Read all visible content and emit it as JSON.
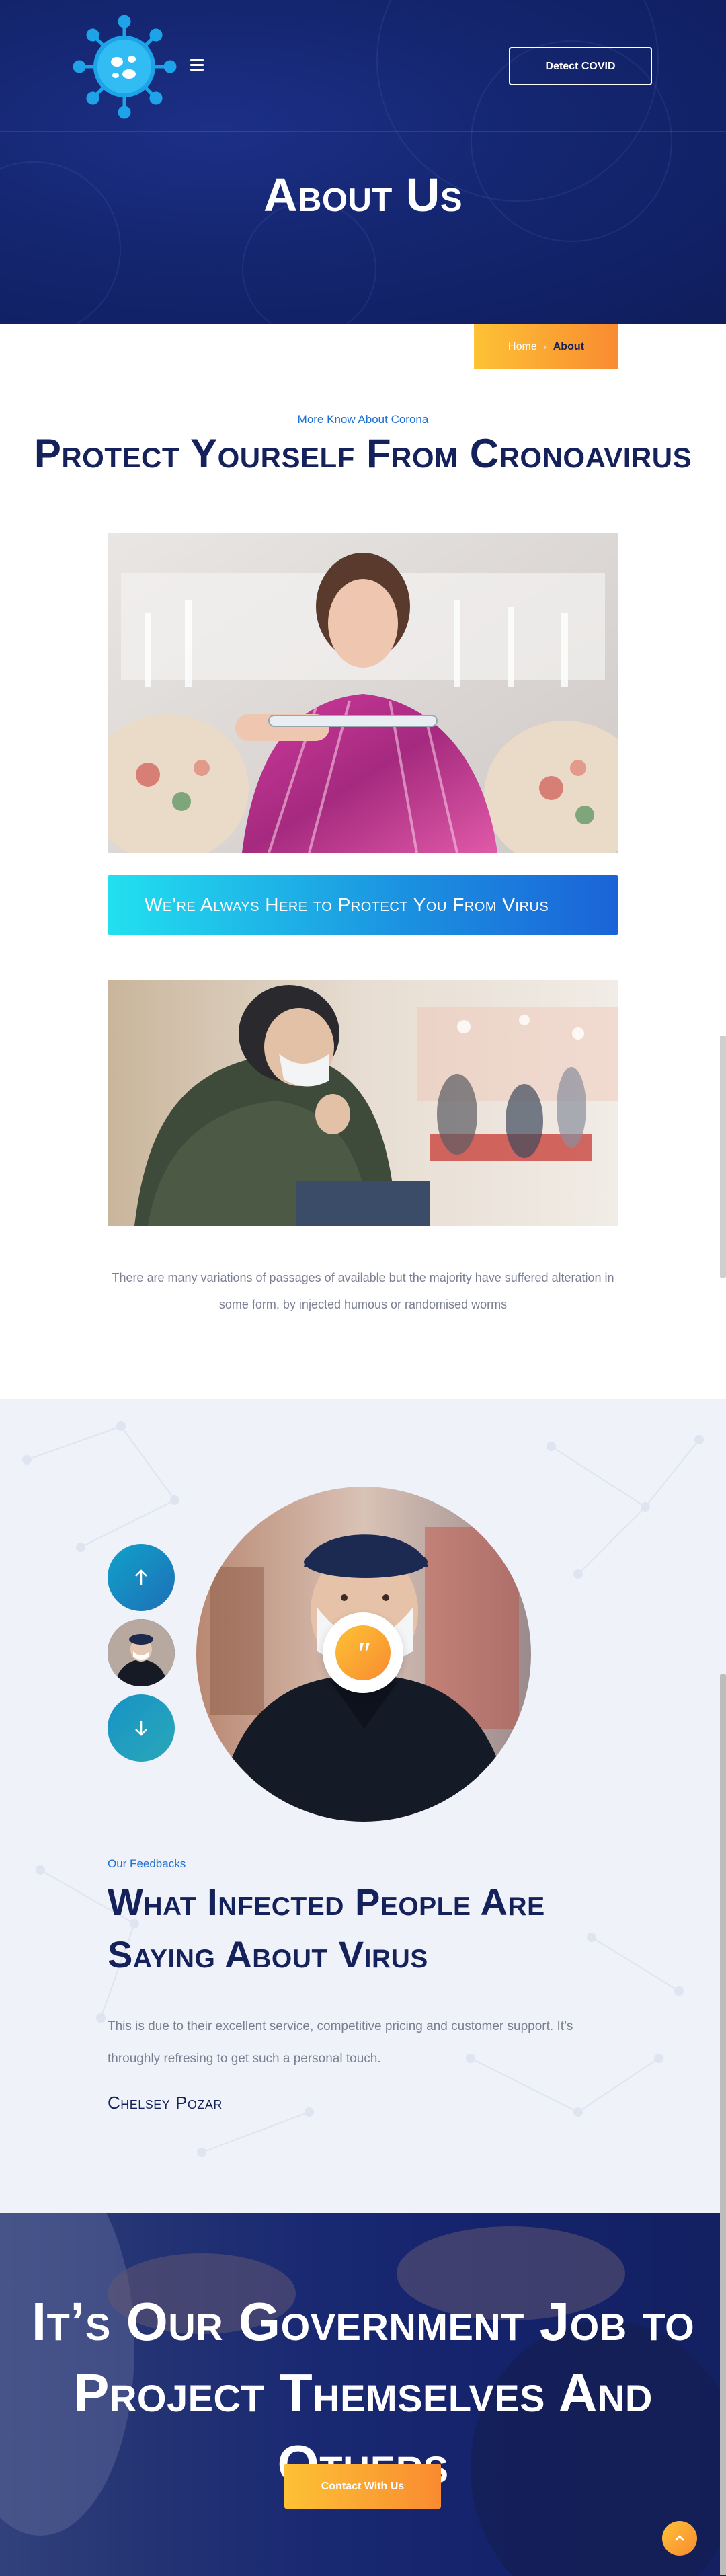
{
  "header": {
    "detect_button": "Detect COVID",
    "page_title": "About Us"
  },
  "breadcrumb": {
    "home": "Home",
    "current": "About"
  },
  "about": {
    "eyebrow": "More Know About Corona",
    "heading": "Protect Yourself From Cronoavirus",
    "banner": "We’re Always Here to Protect You From Virus",
    "text": "There are many variations of passages of available but the majority have suffered alteration in some form, by injected humous or randomised worms"
  },
  "feedback": {
    "eyebrow": "Our Feedbacks",
    "heading": "What Infected People Are Saying About Virus",
    "text": "This is due to their excellent service, competitive pricing and customer support. It’s throughly refresing to get such a personal touch.",
    "author": "Chelsey Pozar",
    "quote_mark": "\""
  },
  "cta": {
    "heading": "It’s Our Government Job to Project Themselves And Others",
    "button": "Contact With Us"
  },
  "colors": {
    "navy": "#14215a",
    "accent_orange": "#f98b31",
    "accent_yellow": "#fdc235",
    "accent_blue": "#1e6fd3",
    "cyan": "#22e0ef"
  },
  "icons": {
    "logo": "virus-logo-icon",
    "menu": "hamburger-menu-icon",
    "up": "arrow-up-icon",
    "down": "arrow-down-icon",
    "scroll_top": "chevron-up-icon",
    "quote": "quote-icon"
  }
}
